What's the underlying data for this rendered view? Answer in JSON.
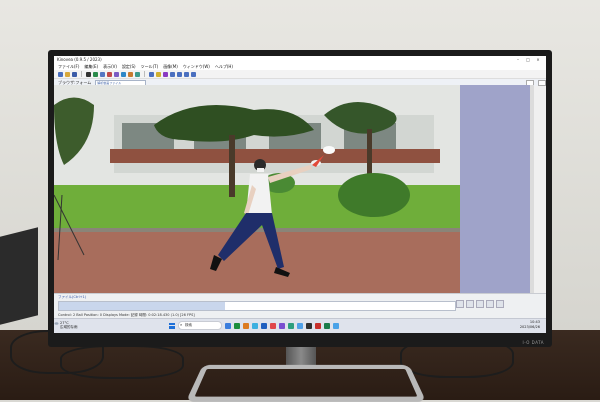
{
  "app": {
    "title": "Kinovea (0.9.5 / 2023)",
    "menu": [
      "ファイル(F)",
      "編集(E)",
      "表示(V)",
      "設定(S)",
      "ツール(T)",
      "画像(M)",
      "ウィンドウ(W)",
      "ヘルプ(H)"
    ],
    "subbar_label": "ブラウザ:フォーム",
    "subbar_field": "解析動画ファイル",
    "control_label": "ファイル(Ctrl+1)",
    "status": "Control: 2   Ball Position: 0   Displays Mode: 記録   時間: 0:02:18.430 (1.0) [26 FPS]",
    "playback_progress": 0.42
  },
  "taskbar": {
    "weather_temp": "27°C",
    "weather_desc": "広域的な雨",
    "search": "検索",
    "time": "10:43",
    "date": "2023/06/26",
    "app_colors": [
      "#3b7ddd",
      "#1c8e3c",
      "#dc7b20",
      "#3db0e0",
      "#1f5fbf",
      "#e0464a",
      "#7a4fd0",
      "#2d9e7e",
      "#4fa0e8",
      "#2f2f2f",
      "#c8302c",
      "#1c7c4a",
      "#4aa3e8"
    ]
  },
  "monitor": {
    "brand": "I-O DATA"
  },
  "colors": {
    "side_panel": "#9fa3c9",
    "timeline_fill": "#c9d6ec"
  }
}
